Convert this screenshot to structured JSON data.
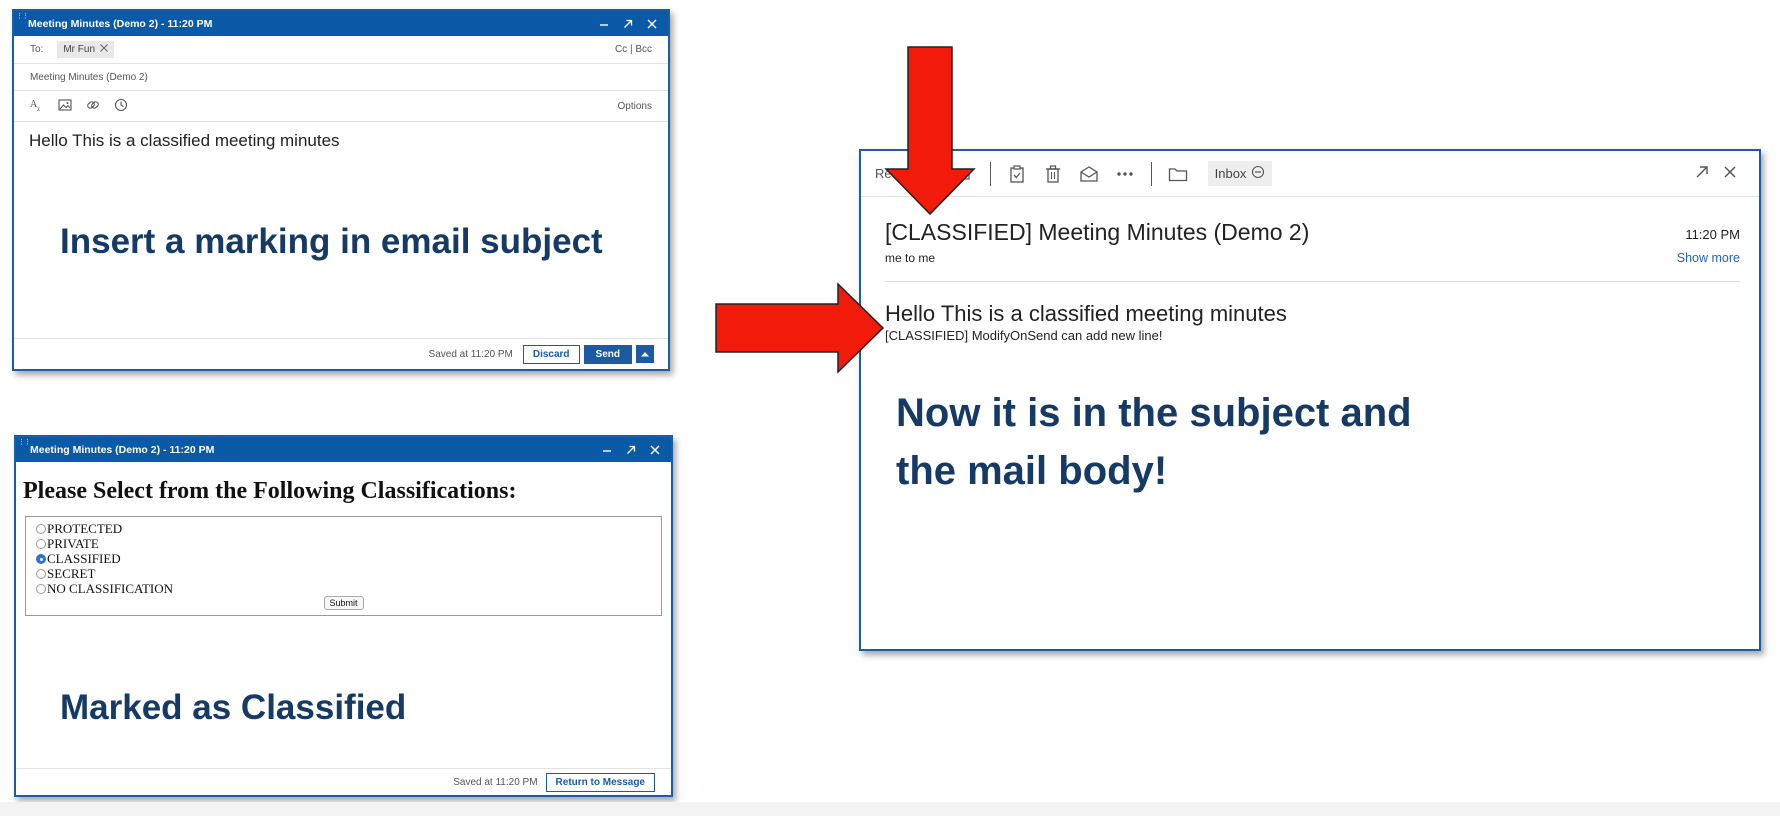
{
  "compose": {
    "title": "Meeting Minutes (Demo 2) - 11:20 PM",
    "to_label": "To:",
    "recipient": "Mr Fun",
    "cc_bcc": "Cc | Bcc",
    "subject": "Meeting Minutes (Demo 2)",
    "options_label": "Options",
    "body": "Hello This is a classified meeting minutes",
    "saved": "Saved at 11:20 PM",
    "discard_label": "Discard",
    "send_label": "Send"
  },
  "caption_compose": "Insert a marking in email subject",
  "classify": {
    "title": "Meeting Minutes (Demo 2) - 11:20 PM",
    "heading": "Please Select from the Following Classifications:",
    "options": [
      "PROTECTED",
      "PRIVATE",
      "CLASSIFIED",
      "SECRET",
      "NO CLASSIFICATION"
    ],
    "selected": "CLASSIFIED",
    "submit_label": "Submit",
    "saved": "Saved at 11:20 PM",
    "return_label": "Return to Message"
  },
  "caption_classify": "Marked as Classified",
  "reader": {
    "reply_label": "Re",
    "folder_label": "Inbox",
    "subject": "[CLASSIFIED] Meeting Minutes (Demo 2)",
    "time": "11:20 PM",
    "from_to": "me to me",
    "show_more": "Show more",
    "body_line1": "Hello This is a classified meeting minutes",
    "body_line2": "[CLASSIFIED] ModifyOnSend can add new line!"
  },
  "caption_reader_line1": "Now it is in the subject and",
  "caption_reader_line2": "the mail body!",
  "colors": {
    "titlebar": "#0a5aa8",
    "accent": "#1a5ba4",
    "caption": "#163a66",
    "arrow": "#f21a0a"
  }
}
